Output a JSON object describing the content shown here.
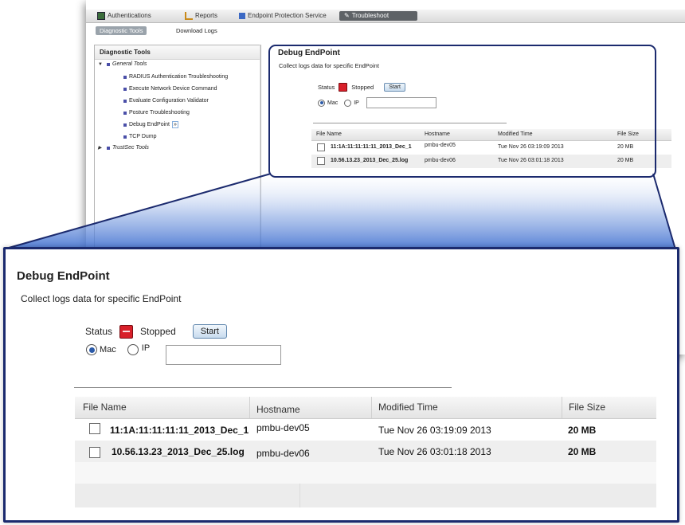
{
  "nav": {
    "tabs": [
      {
        "label": "Authentications"
      },
      {
        "label": "Reports"
      },
      {
        "label": "Endpoint Protection Service"
      },
      {
        "label": "Troubleshoot"
      }
    ],
    "subtabs": [
      {
        "label": "Diagnostic Tools"
      },
      {
        "label": "Download Logs"
      }
    ]
  },
  "sidebar": {
    "title": "Diagnostic Tools",
    "general_group": "General Tools",
    "items": [
      {
        "label": "RADIUS Authentication Troubleshooting"
      },
      {
        "label": "Execute Network Device Command"
      },
      {
        "label": "Evaluate Configuration Validator"
      },
      {
        "label": "Posture Troubleshooting"
      },
      {
        "label": "Debug EndPoint"
      },
      {
        "label": "TCP Dump"
      }
    ],
    "trustsec_group": "TrustSec Tools"
  },
  "debug_small": {
    "title": "Debug EndPoint",
    "description": "Collect logs data for specific EndPoint",
    "status_label": "Status",
    "status_value": "Stopped",
    "start_label": "Start",
    "mac_label": "Mac",
    "ip_label": "IP",
    "columns": [
      "File Name",
      "Hostname",
      "Modified Time",
      "File Size"
    ],
    "rows": [
      {
        "file": "11:1A:11:11:11:11_2013_Dec_1",
        "host": "pmbu-dev05",
        "modified": "Tue Nov 26 03:19:09 2013",
        "size": "20 MB"
      },
      {
        "file": "10.56.13.23_2013_Dec_25.log",
        "host": "pmbu-dev06",
        "modified": "Tue Nov 26 03:01:18 2013",
        "size": "20 MB"
      }
    ]
  },
  "debug_zoom": {
    "title": "Debug EndPoint",
    "description": "Collect logs data for specific EndPoint",
    "status_label": "Status",
    "status_value": "Stopped",
    "start_label": "Start",
    "mac_label": "Mac",
    "ip_label": "IP",
    "ip_value": "",
    "columns": [
      "File Name",
      "Hostname",
      "Modified Time",
      "File Size"
    ],
    "rows": [
      {
        "file": "11:1A:11:11:11:11_2013_Dec_1",
        "host": "pmbu-dev05",
        "modified": "Tue Nov 26 03:19:09 2013",
        "size": "20 MB"
      },
      {
        "file": "10.56.13.23_2013_Dec_25.log",
        "host": "pmbu-dev06",
        "modified": "Tue Nov 26 03:01:18 2013",
        "size": "20 MB"
      }
    ]
  },
  "colors": {
    "callout_border": "#1b2a6e",
    "stop_red": "#d8202a",
    "active_tab": "#5e6266",
    "projection_blue": "#3f6fd0"
  },
  "icons": [
    "authentications-icon",
    "reports-icon",
    "endpoint-protection-icon",
    "troubleshoot-icon",
    "stop-icon",
    "radio-icon",
    "checkbox-icon"
  ]
}
